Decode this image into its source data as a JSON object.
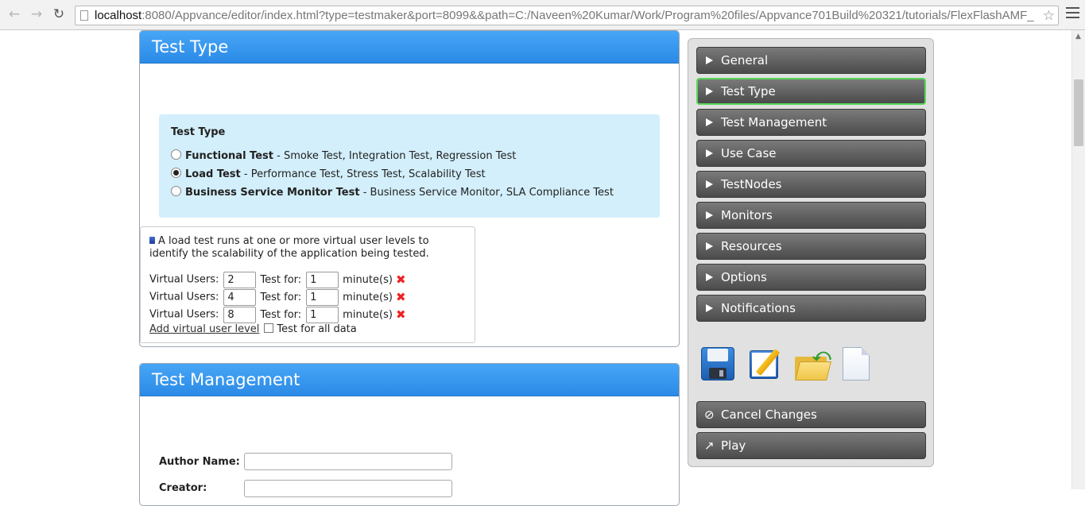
{
  "browser": {
    "url_host": "localhost",
    "url_rest": ":8080/Appvance/editor/index.html?type=testmaker&port=8099&&path=C:/Naveen%20Kumar/Work/Program%20files/Appvance701Build%20321/tutorials/FlexFlashAMF_"
  },
  "test_type_panel": {
    "title": "Test Type",
    "box_title": "Test Type",
    "options": [
      {
        "name": "Functional Test",
        "desc": " - Smoke Test, Integration Test, Regression Test",
        "selected": false
      },
      {
        "name": "Load Test",
        "desc": " - Performance Test, Stress Test, Scalability Test",
        "selected": true
      },
      {
        "name": "Business Service Monitor Test",
        "desc": " - Business Service Monitor, SLA Compliance Test",
        "selected": false
      }
    ],
    "info": "A load test runs at one or more virtual user levels to identify the scalability of the application being tested.",
    "rows": [
      {
        "vu_label": "Virtual Users:",
        "vu": "2",
        "test_label": "Test for:",
        "minutes": "1",
        "unit": "minute(s)"
      },
      {
        "vu_label": "Virtual Users:",
        "vu": "4",
        "test_label": "Test for:",
        "minutes": "1",
        "unit": "minute(s)"
      },
      {
        "vu_label": "Virtual Users:",
        "vu": "8",
        "test_label": "Test for:",
        "minutes": "1",
        "unit": "minute(s)"
      }
    ],
    "add_link": "Add virtual user level",
    "all_data_label": "Test for all data"
  },
  "test_mgmt_panel": {
    "title": "Test Management",
    "author_label": "Author Name:",
    "creator_label": "Creator:"
  },
  "sidebar": {
    "items": [
      {
        "label": "General",
        "active": false
      },
      {
        "label": "Test Type",
        "active": true
      },
      {
        "label": "Test Management",
        "active": false
      },
      {
        "label": "Use Case",
        "active": false
      },
      {
        "label": "TestNodes",
        "active": false
      },
      {
        "label": "Monitors",
        "active": false
      },
      {
        "label": "Resources",
        "active": false
      },
      {
        "label": "Options",
        "active": false
      },
      {
        "label": "Notifications",
        "active": false
      }
    ],
    "tools": [
      "save-icon",
      "edit-icon",
      "open-folder-icon",
      "new-document-icon"
    ],
    "cancel_label": "Cancel Changes",
    "play_label": "Play"
  }
}
